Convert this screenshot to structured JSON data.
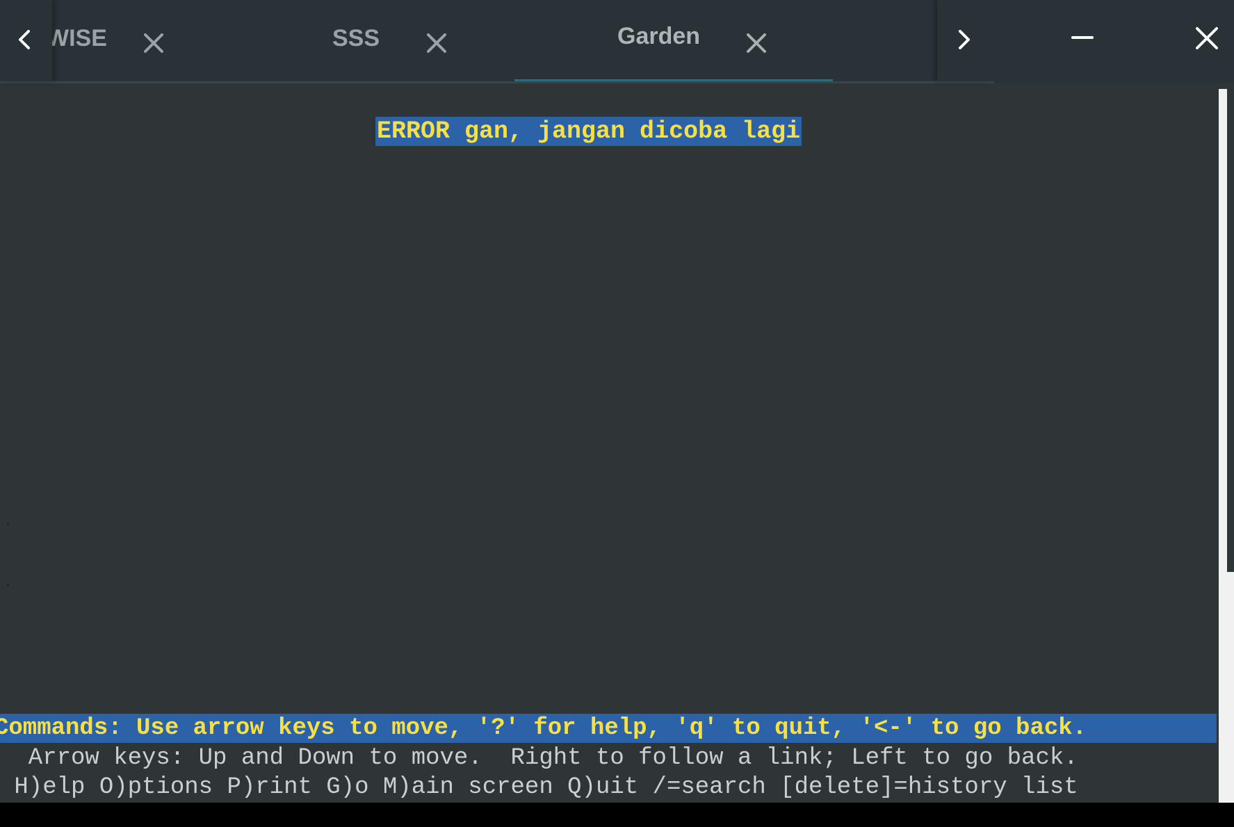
{
  "tabbar": {
    "tabs": [
      {
        "label": "WISE",
        "active": false
      },
      {
        "label": "SSS",
        "active": false
      },
      {
        "label": "Garden",
        "active": true
      }
    ],
    "scroll_left_icon": "chevron-left-icon",
    "scroll_right_icon": "chevron-right-icon",
    "close_icon": "close-icon"
  },
  "window_controls": {
    "minimize_icon": "minimize-icon",
    "close_icon": "close-icon"
  },
  "terminal": {
    "error_message": "ERROR gan, jangan dicoba lagi",
    "commands_bar": "Commands: Use arrow keys to move, '?' for help, 'q' to quit, '<-' to go back.",
    "help_line_1": "  Arrow keys: Up and Down to move.  Right to follow a link; Left to go back.",
    "help_line_2": " H)elp O)ptions P)rint G)o M)ain screen Q)uit /=search [delete]=history list"
  },
  "colors": {
    "background": "#2f3437",
    "tabbar": "#283237",
    "highlight_bg": "#2b62a8",
    "highlight_fg": "#f7e046",
    "active_indicator": "#2b6c78"
  }
}
